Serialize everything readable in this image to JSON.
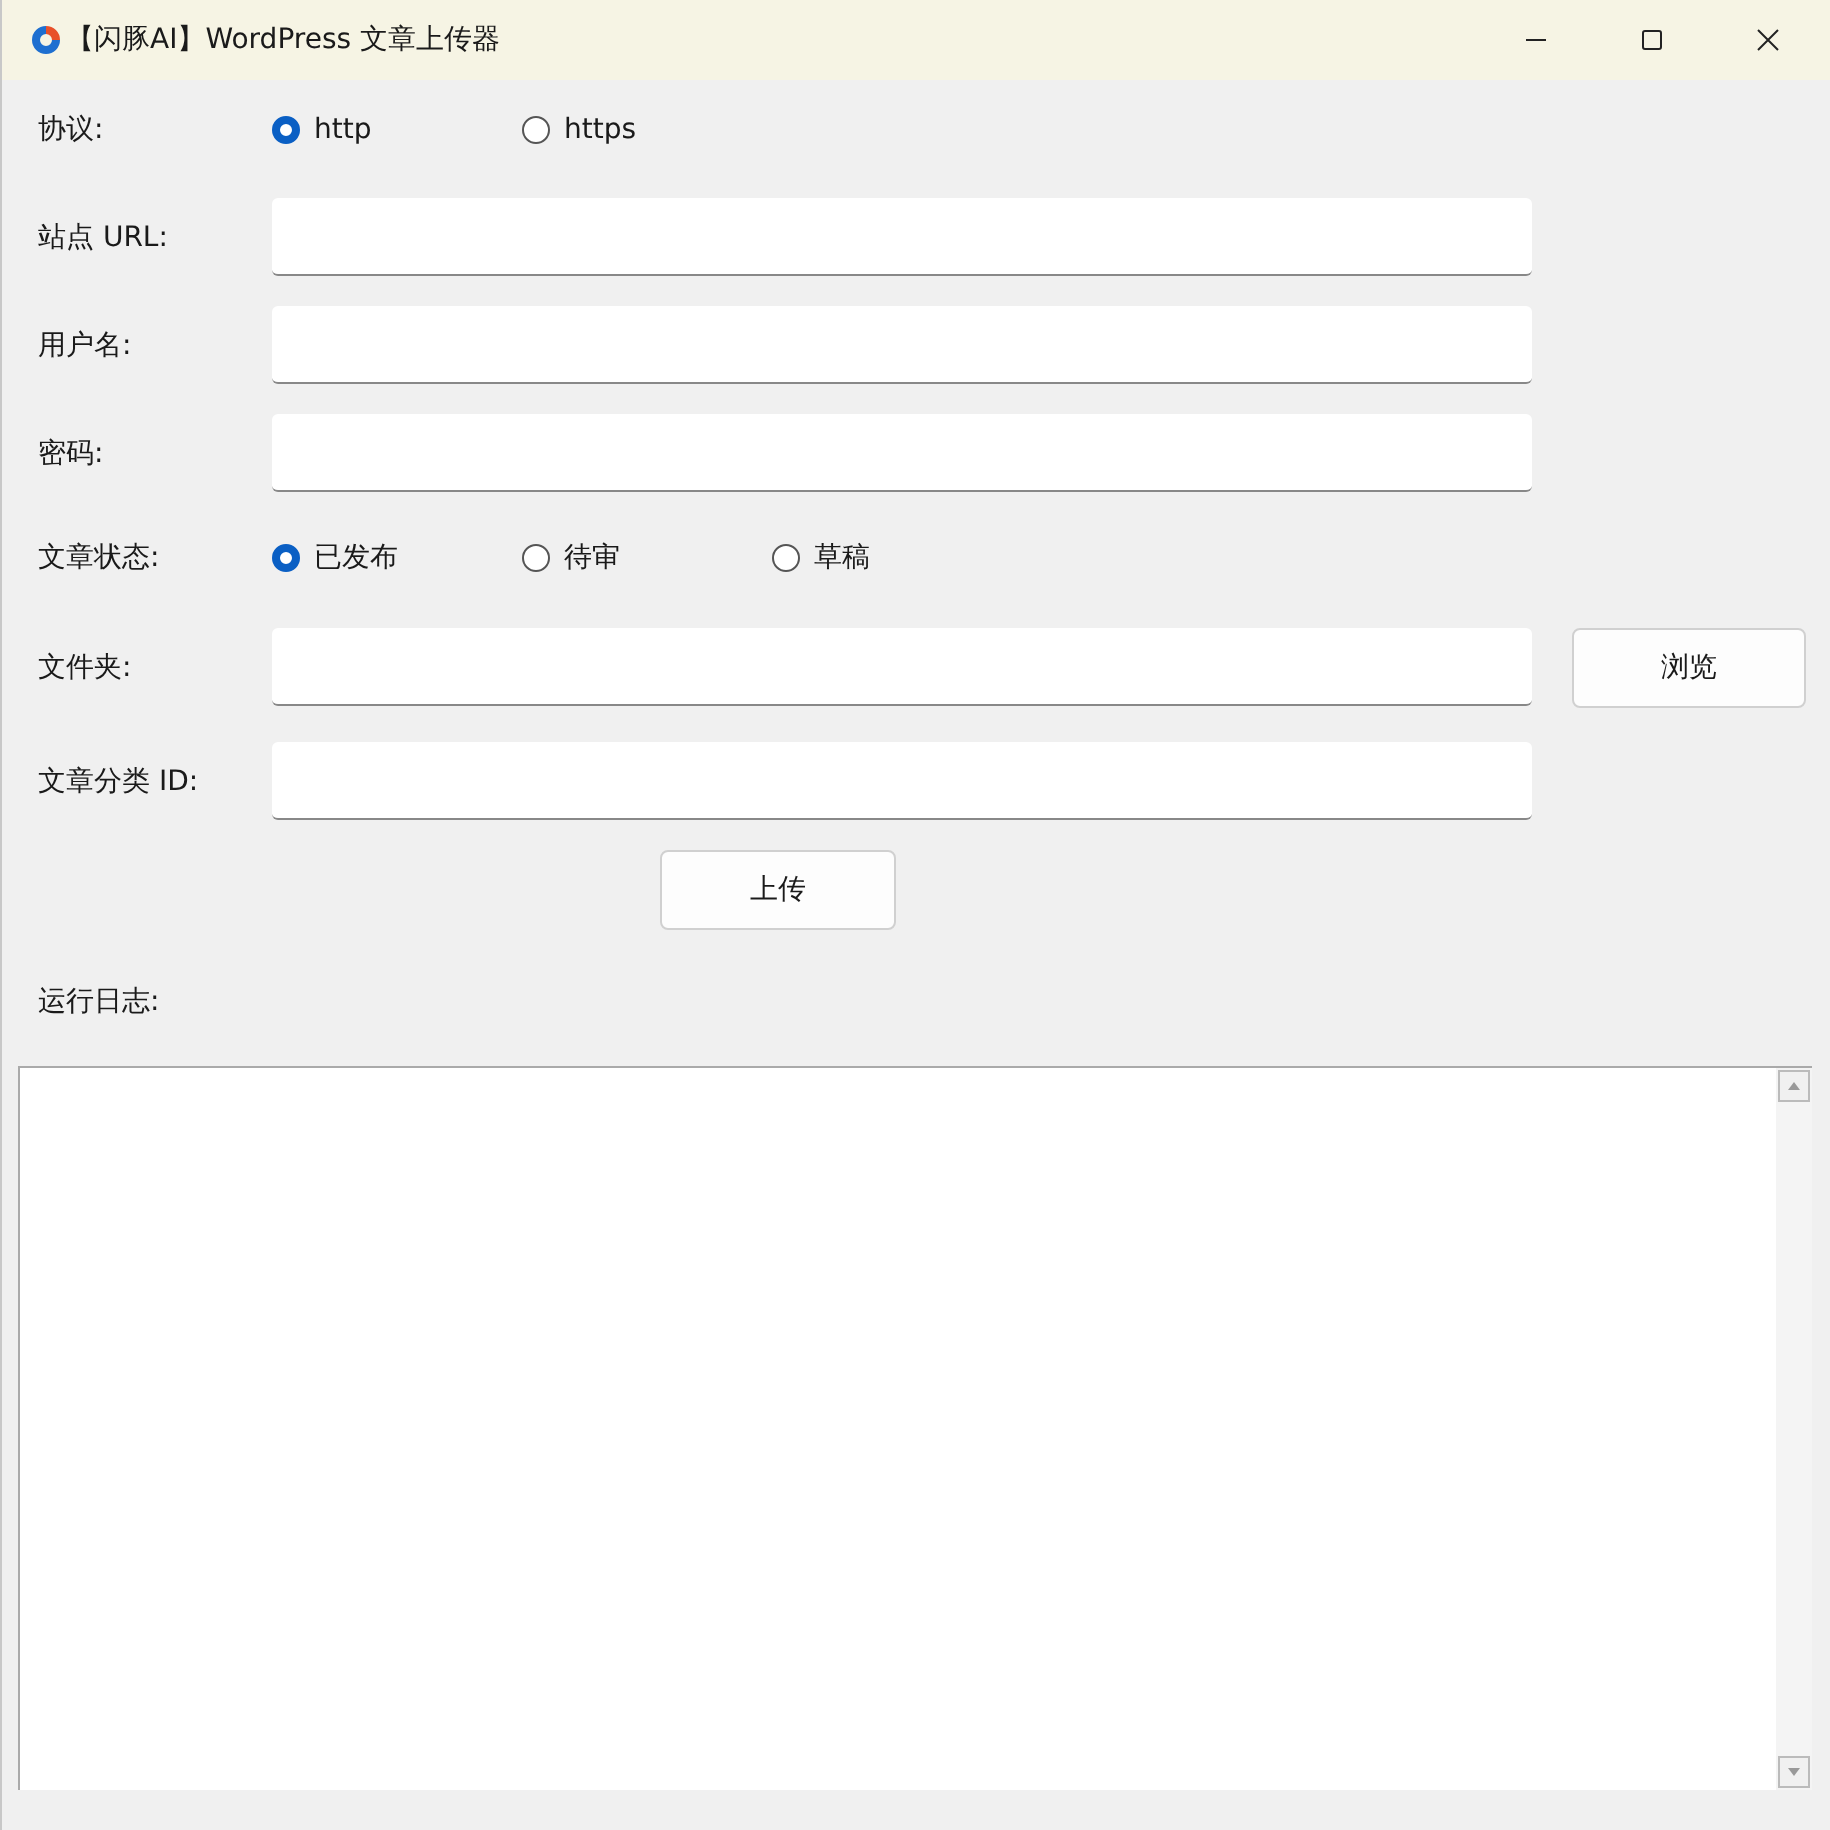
{
  "window": {
    "title": "【闪豚AI】WordPress 文章上传器"
  },
  "protocol": {
    "label": "协议:",
    "options": [
      {
        "label": "http",
        "selected": true
      },
      {
        "label": "https",
        "selected": false
      }
    ]
  },
  "fields": [
    {
      "label": "站点 URL:"
    },
    {
      "label": "用户名:"
    },
    {
      "label": "密码:"
    }
  ],
  "post_status": {
    "label": "文章状态:",
    "options": [
      {
        "label": "已发布",
        "selected": true
      },
      {
        "label": "待审",
        "selected": false
      },
      {
        "label": "草稿",
        "selected": false
      }
    ]
  },
  "folder": {
    "label": "文件夹:",
    "button": "浏览"
  },
  "category": {
    "label": "文章分类 ID:"
  },
  "upload_button": "上传",
  "log": {
    "label": "运行日志:"
  }
}
